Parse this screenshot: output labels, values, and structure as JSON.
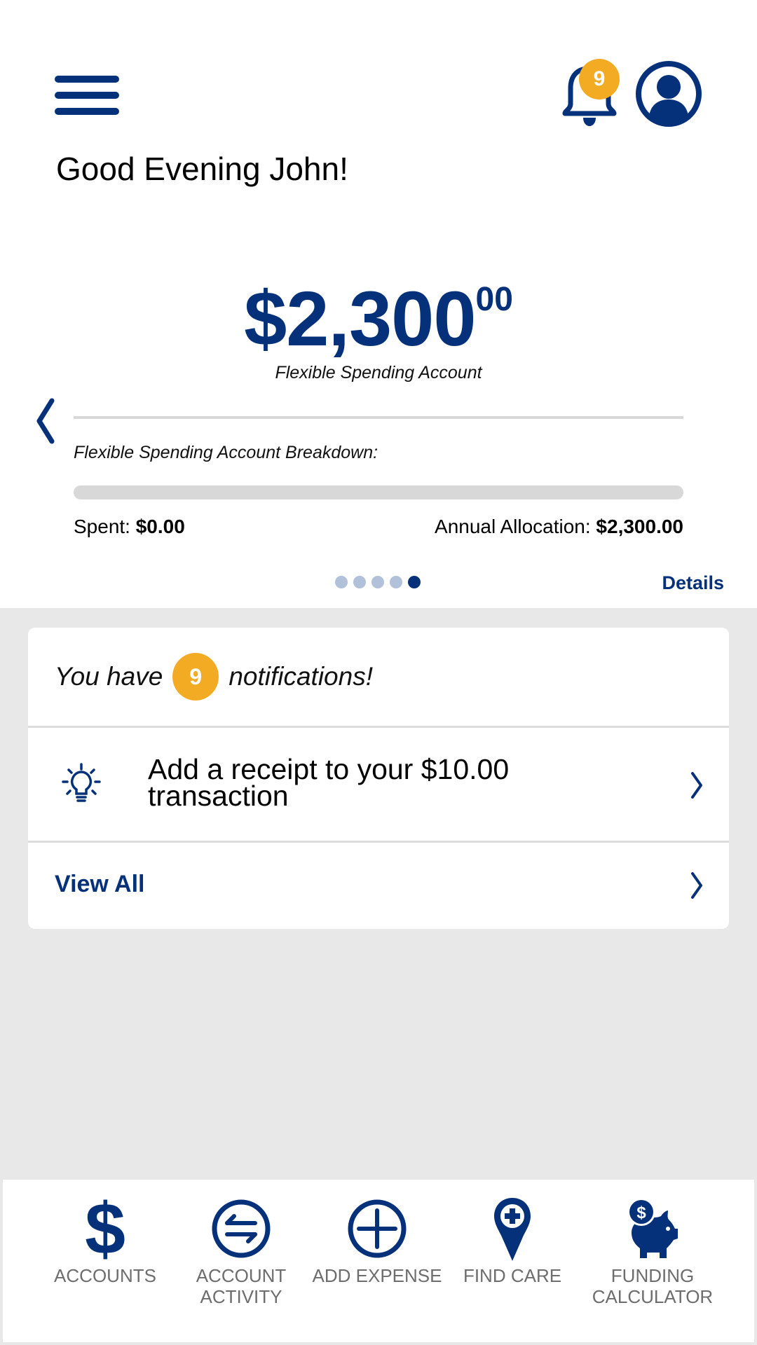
{
  "header": {
    "menu_icon": "hamburger-menu-icon",
    "bell_icon": "bell-icon",
    "notification_count": "9",
    "profile_icon": "user-profile-icon",
    "greeting": "Good Evening John!"
  },
  "account_card": {
    "balance_whole": "$2,300",
    "balance_cents": "00",
    "account_name": "Flexible Spending Account",
    "prev_icon": "chevron-left-icon",
    "breakdown_title": "Flexible Spending Account Breakdown:",
    "spent_progress_fraction": 0.0,
    "spent_label": "Spent:",
    "spent_value": "$0.00",
    "allocation_label": "Annual Allocation:",
    "allocation_value": "$2,300.00",
    "pager": {
      "total": 5,
      "active_index": 4
    },
    "details_label": "Details"
  },
  "notifications": {
    "prefix": "You have",
    "count": "9",
    "suffix": "notifications!",
    "items": [
      {
        "icon": "lightbulb-icon",
        "text": "Add a receipt to your $10.00 transaction"
      }
    ],
    "view_all_label": "View All"
  },
  "bottom_nav": [
    {
      "label": "ACCOUNTS",
      "icon": "dollar-sign-icon"
    },
    {
      "label": "ACCOUNT ACTIVITY",
      "icon": "transfer-arrows-icon"
    },
    {
      "label": "ADD EXPENSE",
      "icon": "plus-circle-icon"
    },
    {
      "label": "FIND CARE",
      "icon": "map-pin-plus-icon"
    },
    {
      "label": "FUNDING CALCULATOR",
      "icon": "piggy-bank-icon"
    }
  ],
  "colors": {
    "brand_blue": "#05317a",
    "badge_orange": "#f3ab24",
    "pager_inactive": "#b1c1d9",
    "background_gray": "#e8e8e8"
  }
}
